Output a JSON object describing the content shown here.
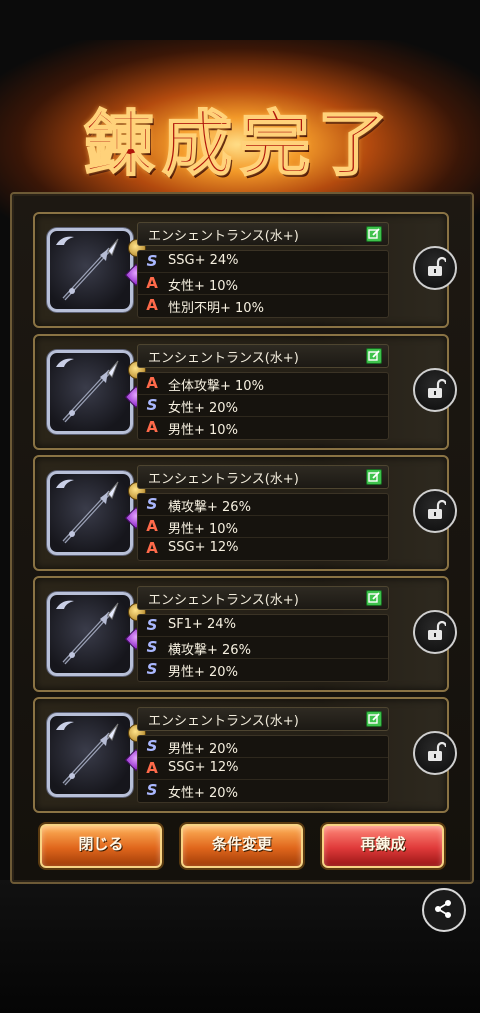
{
  "title": "錬成完了",
  "cards": [
    {
      "name": "エンシェントランス(水+)",
      "stats": [
        {
          "type": "s",
          "icon": "S",
          "text": "SSG+ 24%"
        },
        {
          "type": "a",
          "icon": "A",
          "text": "女性+ 10%"
        },
        {
          "type": "a",
          "icon": "A",
          "text": "性別不明+ 10%"
        }
      ]
    },
    {
      "name": "エンシェントランス(水+)",
      "stats": [
        {
          "type": "a",
          "icon": "A",
          "text": "全体攻撃+ 10%"
        },
        {
          "type": "s",
          "icon": "S",
          "text": "女性+ 20%"
        },
        {
          "type": "a",
          "icon": "A",
          "text": "男性+ 10%"
        }
      ]
    },
    {
      "name": "エンシェントランス(水+)",
      "stats": [
        {
          "type": "s",
          "icon": "S",
          "text": "横攻撃+ 26%"
        },
        {
          "type": "a",
          "icon": "A",
          "text": "男性+ 10%"
        },
        {
          "type": "a",
          "icon": "A",
          "text": "SSG+ 12%"
        }
      ]
    },
    {
      "name": "エンシェントランス(水+)",
      "stats": [
        {
          "type": "s",
          "icon": "S",
          "text": "SF1+ 24%"
        },
        {
          "type": "s",
          "icon": "S",
          "text": "横攻撃+ 26%"
        },
        {
          "type": "s",
          "icon": "S",
          "text": "男性+ 20%"
        }
      ]
    },
    {
      "name": "エンシェントランス(水+)",
      "stats": [
        {
          "type": "s",
          "icon": "S",
          "text": "男性+ 20%"
        },
        {
          "type": "a",
          "icon": "A",
          "text": "SSG+ 12%"
        },
        {
          "type": "s",
          "icon": "S",
          "text": "女性+ 20%"
        }
      ]
    }
  ],
  "buttons": {
    "close": "閉じる",
    "change": "条件変更",
    "reforge": "再錬成"
  },
  "colors": {
    "s_icon": "#aab8ff",
    "a_icon": "#ff6a4a",
    "button_orange": "#e0661c",
    "button_red": "#e03a3a"
  }
}
